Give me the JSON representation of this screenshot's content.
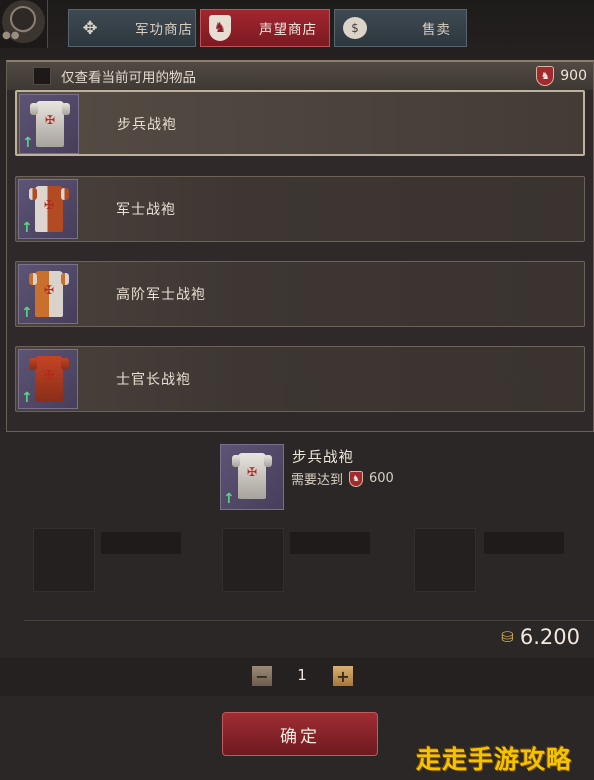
{
  "tabs": [
    {
      "label": "军功商店",
      "icon": "cross-icon"
    },
    {
      "label": "声望商店",
      "icon": "shield-icon",
      "active": true
    },
    {
      "label": "售卖",
      "icon": "coin-bag-icon"
    }
  ],
  "filter": {
    "label": "仅查看当前可用的物品",
    "checked": false
  },
  "reputation": {
    "value": "900"
  },
  "items": [
    {
      "name": "步兵战袍",
      "selected": true
    },
    {
      "name": "军士战袍"
    },
    {
      "name": "高阶军士战袍"
    },
    {
      "name": "士官长战袍"
    }
  ],
  "detail": {
    "name": "步兵战袍",
    "requirement_label": "需要达到",
    "requirement_value": "600"
  },
  "price": "6.200",
  "quantity": "1",
  "confirm_label": "确定",
  "watermark": "走走手游攻略",
  "colors": {
    "accent_red": "#9f2d33",
    "panel": "#2f2a29",
    "upgrade_green": "#5fd08a"
  }
}
